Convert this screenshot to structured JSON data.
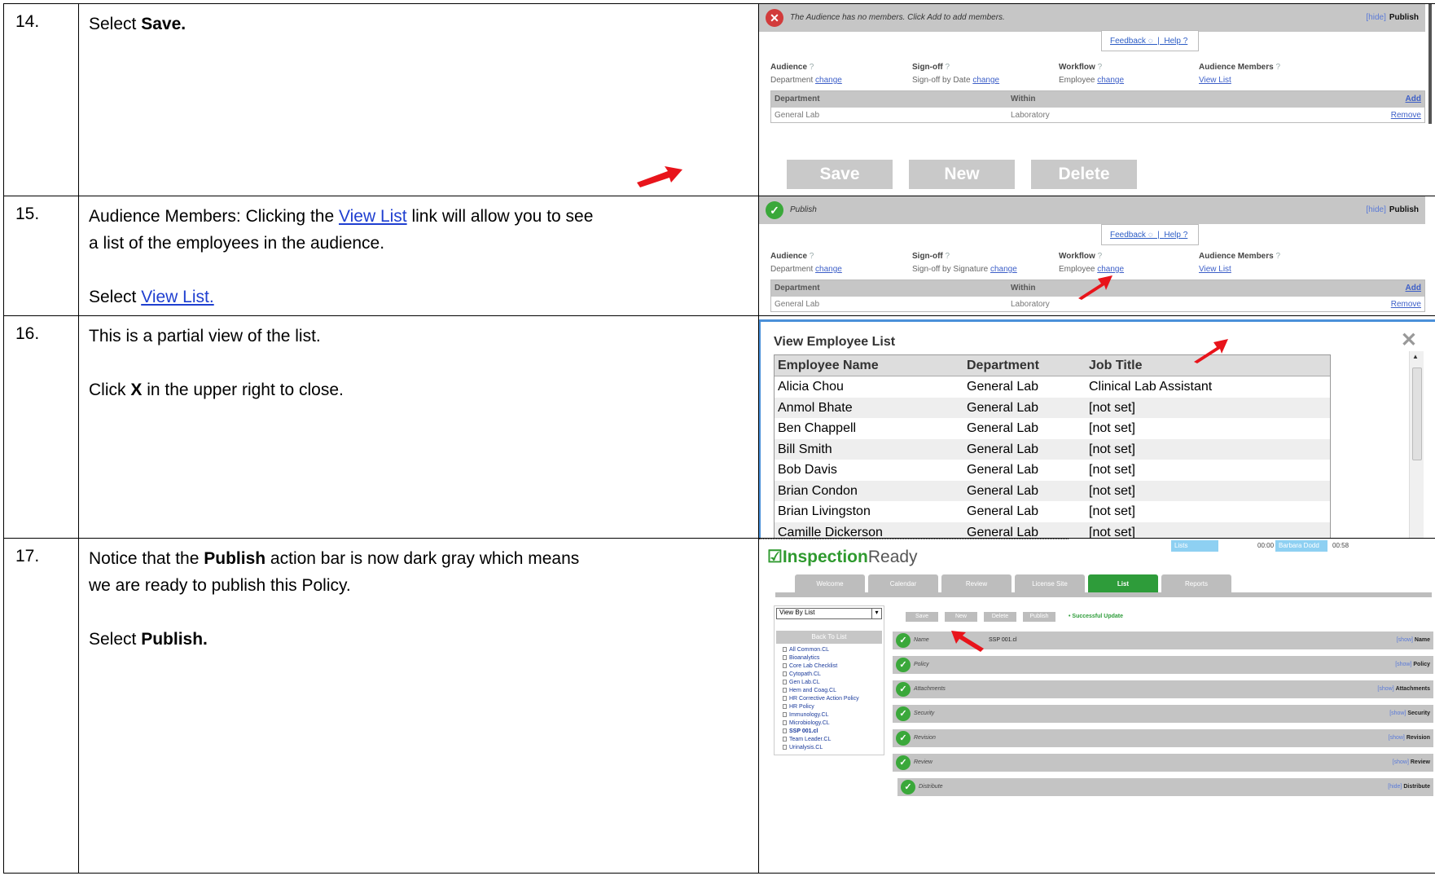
{
  "steps": [
    {
      "num": "14.",
      "text_pre": "Select ",
      "text_bold": "Save.",
      "shot": {
        "error_msg": "The Audience has no members. Click Add to add members.",
        "hide": "[hide]",
        "publish": "Publish",
        "feedback": "Feedback",
        "help": "Help",
        "audience_label": "Audience",
        "audience_value": "Department",
        "signoff_label": "Sign-off",
        "signoff_value": "Sign-off by Date",
        "workflow_label": "Workflow",
        "workflow_value": "Employee",
        "members_label": "Audience Members",
        "members_link": "View List",
        "change": "change",
        "dept_head": "Department",
        "within_head": "Within",
        "add": "Add",
        "dept_value": "General Lab",
        "within_value": "Laboratory",
        "remove": "Remove",
        "btn_save": "Save",
        "btn_new": "New",
        "btn_delete": "Delete"
      }
    },
    {
      "num": "15.",
      "line1_pre": "Audience Members:  Clicking the ",
      "line1_link": "View List",
      "line1_post": " link will allow you to see",
      "line2": "a list of the employees in the audience.",
      "select_pre": "Select ",
      "select_link": "View List.",
      "shot": {
        "status_msg": "Publish",
        "hide": "[hide]",
        "publish": "Publish",
        "feedback": "Feedback",
        "help": "Help",
        "audience_label": "Audience",
        "audience_value": "Department",
        "signoff_label": "Sign-off",
        "signoff_value": "Sign-off by Signature",
        "workflow_label": "Workflow",
        "workflow_value": "Employee",
        "members_label": "Audience Members",
        "members_link": "View List",
        "change": "change",
        "dept_head": "Department",
        "within_head": "Within",
        "add": "Add",
        "dept_value": "General Lab",
        "within_value": "Laboratory",
        "remove": "Remove"
      }
    },
    {
      "num": "16.",
      "line1": "This is a partial view of the list.",
      "click_pre": "Click ",
      "click_bold": "X",
      "click_post": " in the upper right to close.",
      "shot": {
        "title": "View Employee List",
        "close": "✕",
        "headers": [
          "Employee Name",
          "Department",
          "Job Title"
        ],
        "rows": [
          [
            "Alicia Chou",
            "General Lab",
            "Clinical Lab Assistant"
          ],
          [
            "Anmol Bhate",
            "General Lab",
            "[not set]"
          ],
          [
            "Ben Chappell",
            "General Lab",
            "[not set]"
          ],
          [
            "Bill Smith",
            "General Lab",
            "[not set]"
          ],
          [
            "Bob Davis",
            "General Lab",
            "[not set]"
          ],
          [
            "Brian Condon",
            "General Lab",
            "[not set]"
          ],
          [
            "Brian Livingston",
            "General Lab",
            "[not set]"
          ],
          [
            "Camille Dickerson",
            "General Lab",
            "[not set]"
          ]
        ]
      }
    },
    {
      "num": "17.",
      "line1_pre": "Notice that the ",
      "line1_bold": "Publish",
      "line1_post": " action bar is now dark gray which means",
      "line2": "we are ready to publish this Policy.",
      "select_pre": "Select ",
      "select_bold": "Publish.",
      "shot": {
        "logo_check": "☑",
        "logo_a": "Inspection",
        "logo_b": "Ready",
        "badge_lists": "Lists",
        "time1": "00:00",
        "badge_user": "Barbara Dodd",
        "time2": "00:58",
        "tabs": [
          "Welcome",
          "Calendar",
          "Review",
          "License Site",
          "List",
          "Reports"
        ],
        "view_by": "View By List",
        "back": "Back To List",
        "tree": [
          "All Common.CL",
          "Bioanalytics",
          "Core Lab Checklist",
          "Cytopath.CL",
          "Gen Lab.CL",
          "Hem and Coag.CL",
          "HR Corrective Action Policy",
          "HR Policy",
          "Immunology.CL",
          "Microbiology.CL",
          "SSP 001.cl",
          "Team Leader.CL",
          "Urinalysis.CL"
        ],
        "buttons": [
          "Save",
          "New",
          "Delete",
          "Publish"
        ],
        "success": "• Successful Update",
        "sections": [
          {
            "label": "Name",
            "value": "SSP 001.cl",
            "link": "[show]",
            "right": "Name"
          },
          {
            "label": "Policy",
            "value": "",
            "link": "[show]",
            "right": "Policy"
          },
          {
            "label": "Attachments",
            "value": "",
            "link": "[show]",
            "right": "Attachments"
          },
          {
            "label": "Security",
            "value": "",
            "link": "[show]",
            "right": "Security"
          },
          {
            "label": "Revision",
            "value": "",
            "link": "[show]",
            "right": "Revision"
          },
          {
            "label": "Review",
            "value": "",
            "link": "[show]",
            "right": "Review"
          },
          {
            "label": "Distribute",
            "value": "",
            "link": "[hide]",
            "right": "Distribute"
          }
        ]
      }
    }
  ],
  "colors": {
    "arrow": "#e8141b",
    "link": "#1f3fd0",
    "green": "#2e9c3a",
    "bar_gray": "#c6c6c6"
  }
}
